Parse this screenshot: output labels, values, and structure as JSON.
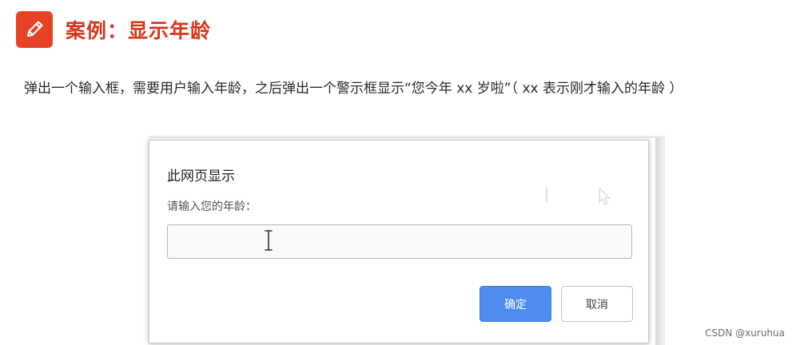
{
  "header": {
    "icon": "pencil-icon",
    "title": "案例：显示年龄",
    "accent_color": "#e84226"
  },
  "instruction": "弹出一个输入框，需要用户输入年龄，之后弹出一个警示框显示“您今年 xx 岁啦”（ xx 表示刚才输入的年龄 ）",
  "dialog": {
    "title": "此网页显示",
    "prompt": "请输入您的年龄：",
    "input_value": "",
    "ok_label": "确定",
    "cancel_label": "取消",
    "ok_color": "#4f8cf0"
  },
  "watermark": "CSDN @xuruhua"
}
